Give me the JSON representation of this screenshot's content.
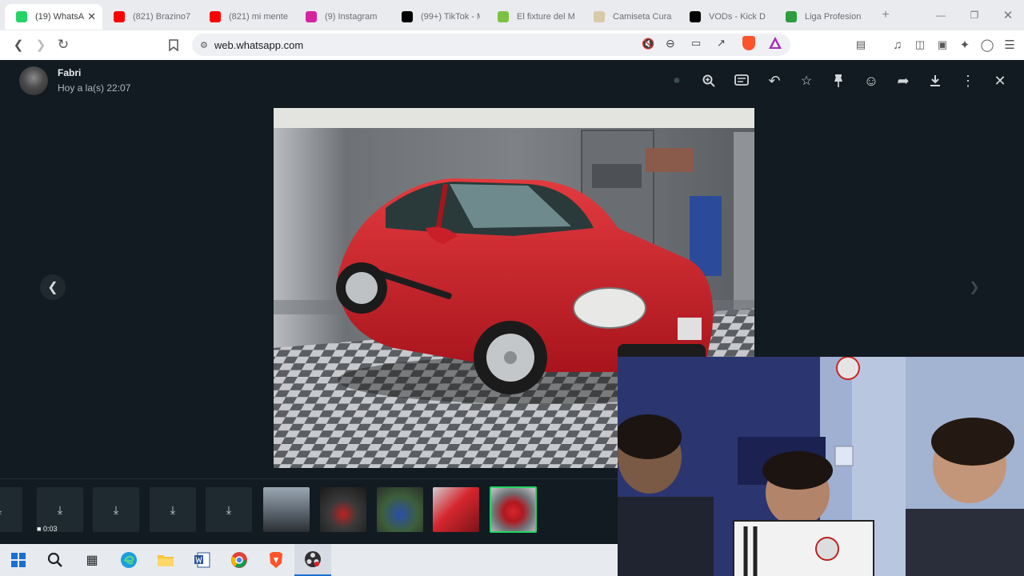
{
  "browser": {
    "tabs": [
      {
        "title": "(19) WhatsApp",
        "icon": "whatsapp-icon",
        "color": "#25d366",
        "active": true
      },
      {
        "title": "(821) Brazino7",
        "icon": "youtube-icon",
        "color": "#ff0000",
        "active": false
      },
      {
        "title": "(821) mi mente",
        "icon": "youtube-icon",
        "color": "#ff0000",
        "active": false
      },
      {
        "title": "(9) Instagram",
        "icon": "instagram-icon",
        "color": "#d6249f",
        "active": false
      },
      {
        "title": "(99+) TikTok - M",
        "icon": "tiktok-icon",
        "color": "#000000",
        "active": false
      },
      {
        "title": "El fixture del M",
        "icon": "olé-icon",
        "color": "#7cc242",
        "active": false
      },
      {
        "title": "Camiseta Cura",
        "icon": "shop-icon",
        "color": "#d8c9a8",
        "active": false
      },
      {
        "title": "VODs - Kick D",
        "icon": "kick-icon",
        "color": "#000000",
        "active": false
      },
      {
        "title": "Liga Profesion",
        "icon": "ball-icon",
        "color": "#2e9c3d",
        "active": false
      }
    ],
    "new_tab": "+",
    "url": "web.whatsapp.com"
  },
  "viewer": {
    "sender": "Fabri",
    "timestamp": "Hoy a la(s) 22:07",
    "video_duration": "0:03"
  }
}
